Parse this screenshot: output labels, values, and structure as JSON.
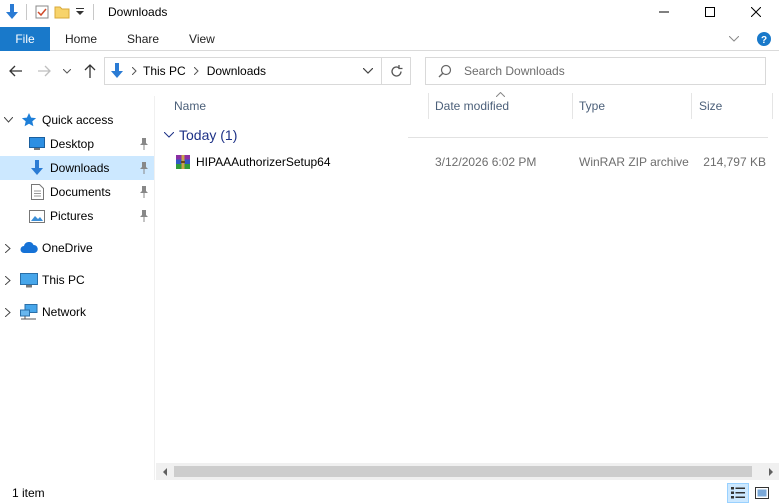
{
  "window": {
    "title": "Downloads"
  },
  "ribbon": {
    "tabs": [
      "File",
      "Home",
      "Share",
      "View"
    ]
  },
  "address": {
    "crumbs": [
      "This PC",
      "Downloads"
    ]
  },
  "search": {
    "placeholder": "Search Downloads"
  },
  "sidebar": {
    "quick_access": "Quick access",
    "items": [
      "Desktop",
      "Downloads",
      "Documents",
      "Pictures"
    ],
    "onedrive": "OneDrive",
    "this_pc": "This PC",
    "network": "Network"
  },
  "columns": {
    "name": "Name",
    "date": "Date modified",
    "type": "Type",
    "size": "Size"
  },
  "group": {
    "label": "Today (1)"
  },
  "files": [
    {
      "name": "HIPAAAuthorizerSetup64",
      "date": "3/12/2026 6:02 PM",
      "type": "WinRAR ZIP archive",
      "size": "214,797 KB"
    }
  ],
  "status": {
    "count": "1 item"
  },
  "colors": {
    "accent": "#1979ca",
    "selected": "#cce8ff",
    "group_text": "#1e3287",
    "header_text": "#4c607a"
  }
}
